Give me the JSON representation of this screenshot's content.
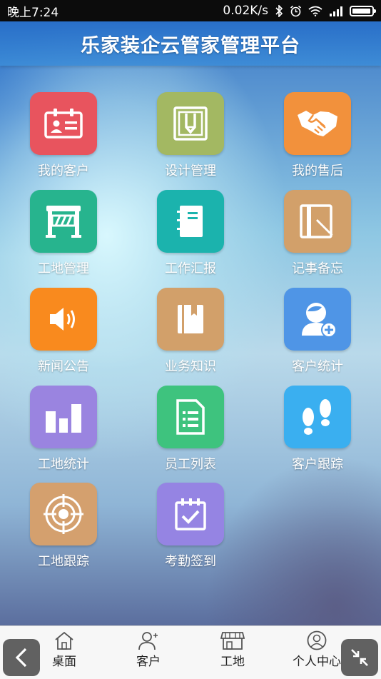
{
  "status_bar": {
    "time": "晚上7:24",
    "network_speed": "0.02K/s",
    "battery_level": 0.95,
    "icons": [
      "bluetooth-icon",
      "alarm-icon",
      "wifi-icon",
      "signal-icon",
      "battery-icon"
    ]
  },
  "header": {
    "title": "乐家装企云管家管理平台"
  },
  "tiles": [
    {
      "label": "我的客户",
      "icon": "id-card-icon",
      "color": "#e8545e"
    },
    {
      "label": "设计管理",
      "icon": "design-frame-icon",
      "color": "#a3b862"
    },
    {
      "label": "我的售后",
      "icon": "handshake-icon",
      "color": "#f2913c"
    },
    {
      "label": "工地管理",
      "icon": "construction-barrier-icon",
      "color": "#27b48e"
    },
    {
      "label": "工作汇报",
      "icon": "notebook-icon",
      "color": "#1bb3ad"
    },
    {
      "label": "记事备忘",
      "icon": "memo-pencil-icon",
      "color": "#d2a06a"
    },
    {
      "label": "新闻公告",
      "icon": "speaker-icon",
      "color": "#f98a1e"
    },
    {
      "label": "业务知识",
      "icon": "book-bookmark-icon",
      "color": "#d2a06a"
    },
    {
      "label": "客户统计",
      "icon": "user-add-icon",
      "color": "#4f95e6"
    },
    {
      "label": "工地统计",
      "icon": "bar-chart-icon",
      "color": "#9a84e0"
    },
    {
      "label": "员工列表",
      "icon": "document-list-icon",
      "color": "#3ec37e"
    },
    {
      "label": "客户跟踪",
      "icon": "footprints-icon",
      "color": "#3aaff0"
    },
    {
      "label": "工地跟踪",
      "icon": "target-icon",
      "color": "#d4a06e"
    },
    {
      "label": "考勤签到",
      "icon": "calendar-check-icon",
      "color": "#9584e3"
    }
  ],
  "bottom_nav": [
    {
      "label": "桌面",
      "icon": "home-icon"
    },
    {
      "label": "客户",
      "icon": "customer-icon"
    },
    {
      "label": "工地",
      "icon": "shop-icon"
    },
    {
      "label": "个人中心",
      "icon": "profile-icon"
    }
  ],
  "float_buttons": [
    {
      "icon": "back-arrow-icon"
    },
    {
      "icon": "collapse-icon"
    }
  ]
}
